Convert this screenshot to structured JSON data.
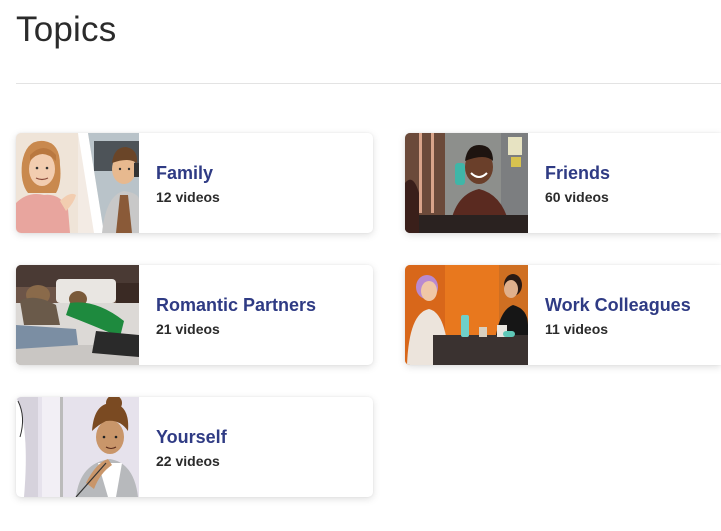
{
  "page": {
    "title": "Topics"
  },
  "colors": {
    "title_text": "#2b2b2b",
    "card_title": "#2f3b84",
    "card_count": "#2b2b2b",
    "divider": "#e3e3e3"
  },
  "topics": [
    {
      "title": "Family",
      "count": "12 videos",
      "thumbnail": "illustration-family-phone-call"
    },
    {
      "title": "Friends",
      "count": "60 videos",
      "thumbnail": "photo-smiling-man-at-table"
    },
    {
      "title": "Romantic Partners",
      "count": "21 videos",
      "thumbnail": "photo-couple-lying-on-bed"
    },
    {
      "title": "Work Colleagues",
      "count": "11 videos",
      "thumbnail": "photo-two-women-at-table"
    },
    {
      "title": "Yourself",
      "count": "22 videos",
      "thumbnail": "illustration-person-thinking"
    }
  ]
}
